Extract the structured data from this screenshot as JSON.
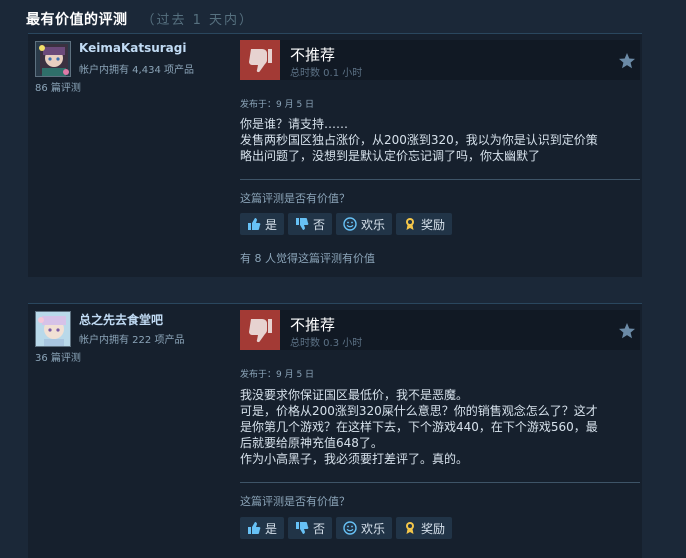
{
  "section": {
    "title": "最有价值的评测",
    "subtitle": "（过去 1 天内）"
  },
  "colors": {
    "background": "#1b2838",
    "thumb_down_bg": "#a33a35",
    "author_name": "#c1dbf4",
    "button_bg": "#213447"
  },
  "reviews": [
    {
      "author": {
        "name": "KeimaKatsuragi",
        "owned": "帐户内拥有 4,434 项产品",
        "review_count": "86 篇评测"
      },
      "verdict": "不推荐",
      "hours": "总时数 0.1 小时",
      "posted": "发布于：9 月 5 日",
      "lines": [
        "你是谁？请支持……",
        "发售两秒国区独占涨价，从200涨到320，我以为你是认识到定价策",
        "略出问题了，没想到是默认定价忘记调了吗，你太幽默了"
      ],
      "helpful_question": "这篇评测是否有价值？",
      "buttons": {
        "yes": "是",
        "no": "否",
        "funny": "欢乐",
        "award": "奖励"
      },
      "helpful_count": "有 8 人觉得这篇评测有价值",
      "icons": {
        "verdict": "thumbs-down-icon",
        "award": "award-star-icon"
      }
    },
    {
      "author": {
        "name": "总之先去食堂吧",
        "owned": "帐户内拥有 222 项产品",
        "review_count": "36 篇评测"
      },
      "verdict": "不推荐",
      "hours": "总时数 0.3 小时",
      "posted": "发布于：9 月 5 日",
      "lines": [
        "我没要求你保证国区最低价，我不是恶魔。",
        "可是，价格从200涨到320屎什么意思？你的销售观念怎么了？这才",
        "是你第几个游戏？在这样下去，下个游戏440，在下个游戏560，最",
        "后就要给原神充值648了。",
        "作为小高黑子，我必须要打差评了。真的。"
      ],
      "helpful_question": "这篇评测是否有价值？",
      "buttons": {
        "yes": "是",
        "no": "否",
        "funny": "欢乐",
        "award": "奖励"
      },
      "icons": {
        "verdict": "thumbs-down-icon",
        "award": "award-star-icon"
      }
    }
  ]
}
